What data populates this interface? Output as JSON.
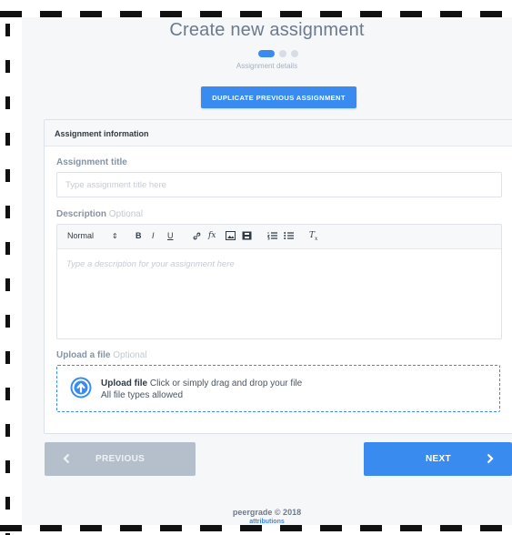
{
  "page": {
    "title": "Create new assignment",
    "step_label": "Assignment details",
    "steps_total": 3,
    "current_step": 1
  },
  "duplicate_button": "DUPLICATE PREVIOUS ASSIGNMENT",
  "card": {
    "header": "Assignment information",
    "title_label": "Assignment title",
    "title_placeholder": "Type assignment title here",
    "description_label": "Description",
    "description_optional": "Optional",
    "description_placeholder": "Type a description for your assignment here",
    "toolbar": {
      "format_select": "Normal",
      "bold": "B",
      "italic": "I",
      "underline": "U"
    },
    "upload_label": "Upload a file",
    "upload_optional": "Optional",
    "upload_title": "Upload file",
    "upload_hint": "Click or simply drag and drop your file",
    "upload_types": "All file types allowed"
  },
  "nav": {
    "previous": "PREVIOUS",
    "next": "NEXT"
  },
  "footer": {
    "copyright": "peergrade © 2018",
    "attributions": "attributions"
  },
  "colors": {
    "accent": "#3a8bf0",
    "disabled": "#b4bfcb",
    "background": "#f6f7f9"
  },
  "icons": [
    "upload-arrow-icon",
    "link-icon",
    "formula-icon",
    "image-icon",
    "video-icon",
    "ordered-list-icon",
    "bullet-list-icon",
    "clear-format-icon",
    "chevron-left-icon",
    "chevron-right-icon"
  ]
}
